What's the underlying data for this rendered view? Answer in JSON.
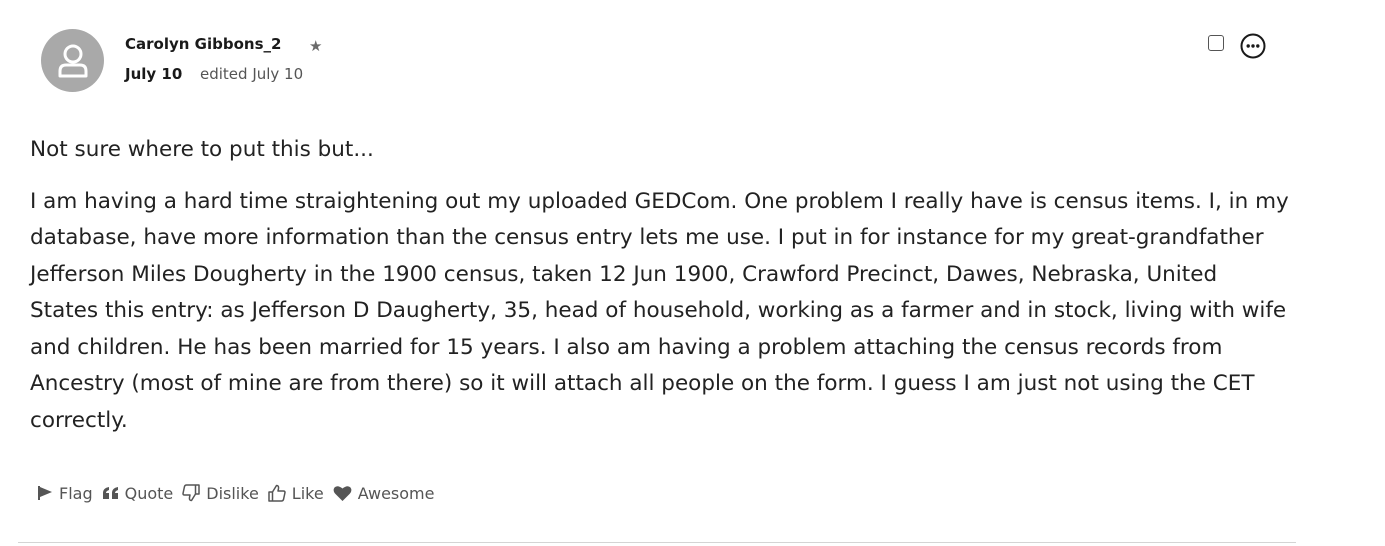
{
  "post": {
    "author": "Carolyn Gibbons_2",
    "date": "July 10",
    "edited": "edited July 10",
    "paragraphs": [
      "Not sure where to put this but...",
      "I am having a hard time straightening out my uploaded GEDCom. One problem I really have is census items. I, in my database, have more information than the census entry lets me use. I put in for instance for my great-grandfather Jefferson Miles Dougherty in the 1900 census, taken 12 Jun 1900, Crawford Precinct, Dawes, Nebraska, United States this entry: as Jefferson D Daugherty, 35, head of household, working as a farmer and in stock, living with wife and children. He has been married for 15 years. I also am having a problem attaching the census records from Ancestry (most of mine are from there) so it will attach all people on the form. I guess I am just not using the CET correctly."
    ]
  },
  "reactions": [
    {
      "label": "Flag",
      "icon": "flag-icon"
    },
    {
      "label": "Quote",
      "icon": "quote-icon"
    },
    {
      "label": "Dislike",
      "icon": "thumbs-down-icon"
    },
    {
      "label": "Like",
      "icon": "thumbs-up-icon"
    },
    {
      "label": "Awesome",
      "icon": "heart-icon"
    }
  ],
  "icons": {
    "avatar": "user-icon",
    "author_badge": "star-icon",
    "select": "checkbox-icon",
    "options": "more-options-icon"
  },
  "colors": {
    "avatar_bg": "#a9a9a9",
    "text": "#222222",
    "muted": "#555555",
    "divider": "#d4d4d4"
  }
}
